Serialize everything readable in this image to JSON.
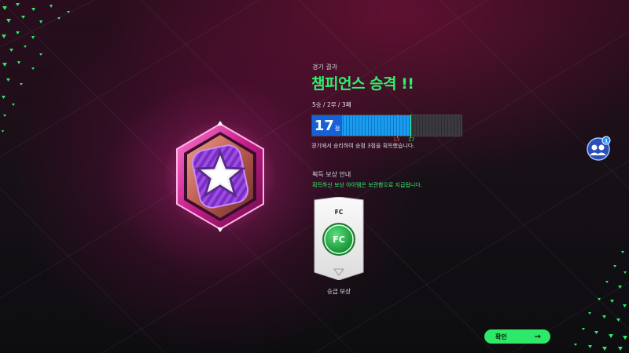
{
  "result": {
    "label": "경기 결과",
    "title": "챔피언스 승격 !!",
    "record": "5승 / 2무 / 3패"
  },
  "score": {
    "value": "17",
    "unit": "점",
    "progress_fraction": 0.66,
    "marker_red": "13",
    "marker_green": "17",
    "description": "경기에서 승리하여 승점 3점을 획득했습니다."
  },
  "reward": {
    "title": "획득 보상 안내",
    "description": "획득하신 보상 아이템은 보관함으로 지급됩니다.",
    "card_label": "FC",
    "card_emblem": "FC",
    "card_caption": "승급 보상"
  },
  "buttons": {
    "confirm_label": "확인",
    "confirm_arrow": "→"
  },
  "notification": {
    "count": "1"
  },
  "colors": {
    "accent_green": "#2ef06c",
    "bar_blue": "#1a9cf0",
    "marker_red": "#ff4b4b",
    "badge_pink": "#e0309a",
    "badge_purple": "#7a2cc4"
  },
  "icons": {
    "rank_badge": "star-badge-icon",
    "confirm": "arrow-right-icon",
    "floating": "team-chat-icon"
  }
}
